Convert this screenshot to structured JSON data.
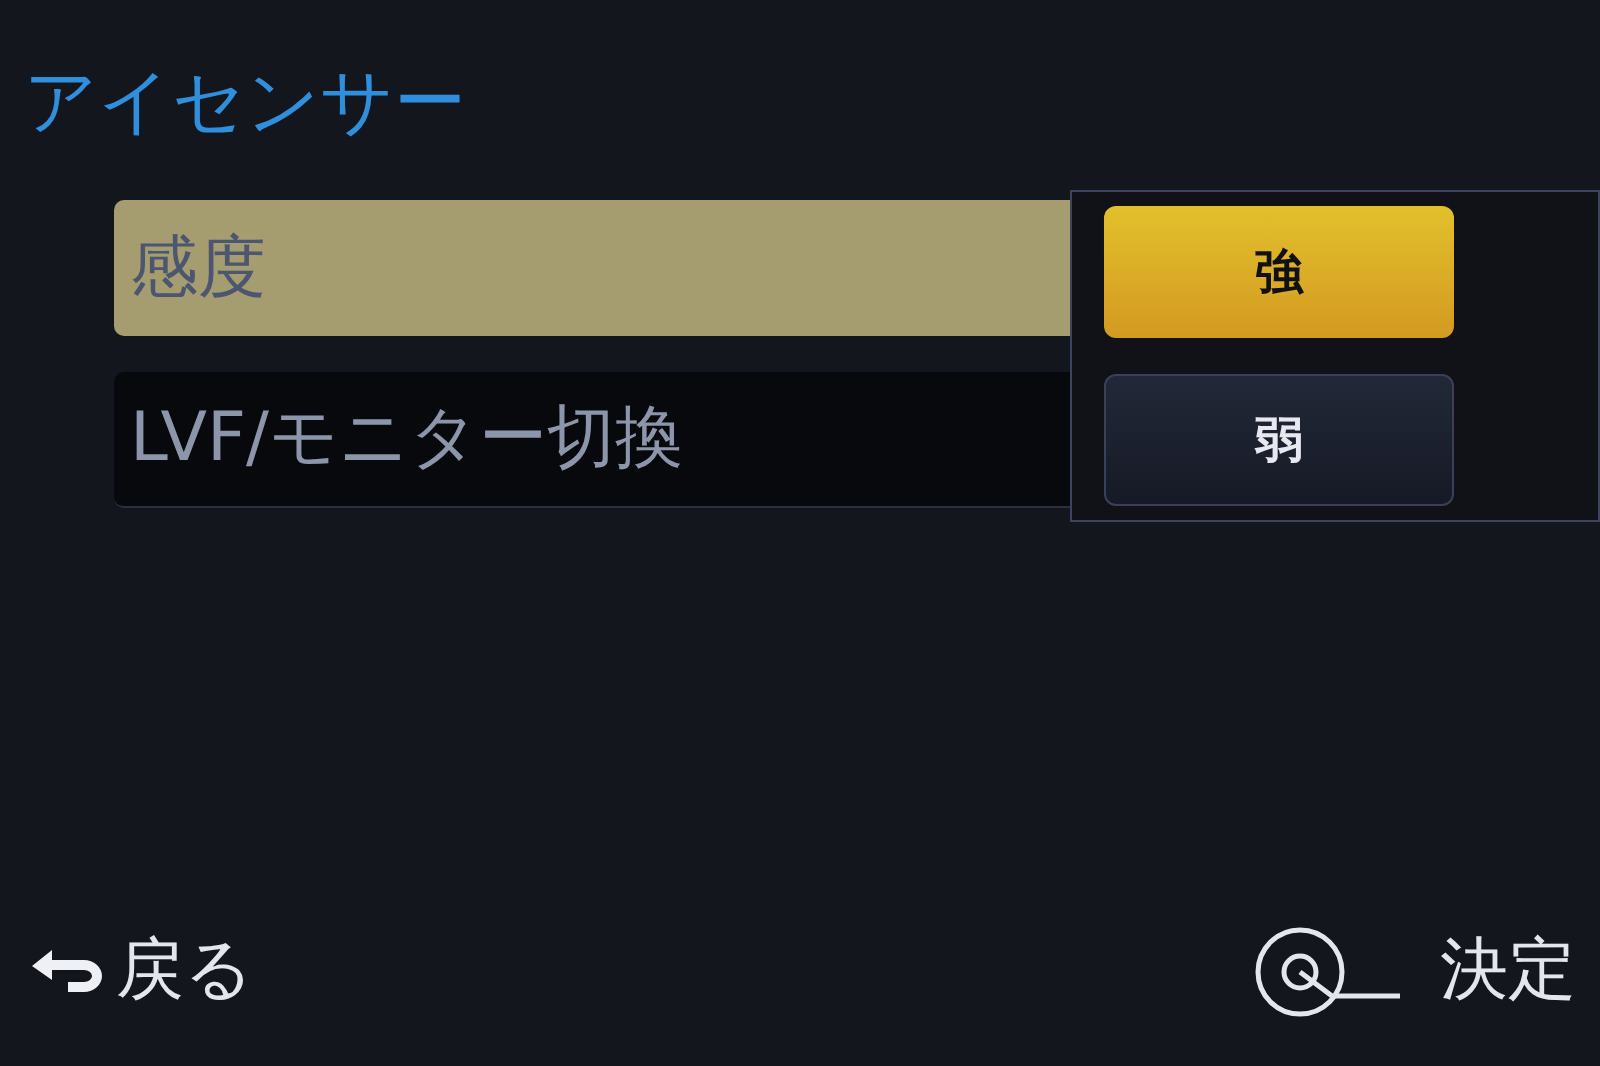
{
  "title": "アイセンサー",
  "menu_items": [
    {
      "label": "感度",
      "selected": true
    },
    {
      "label": "LVF/モニター切換",
      "selected": false
    }
  ],
  "options": [
    {
      "label": "強",
      "selected": true
    },
    {
      "label": "弱",
      "selected": false
    }
  ],
  "footer": {
    "back": "戻る",
    "confirm": "決定"
  }
}
